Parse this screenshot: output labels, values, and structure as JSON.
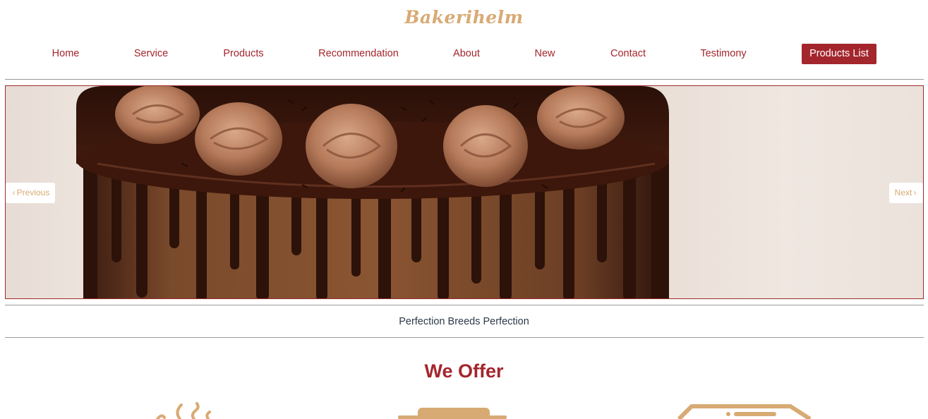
{
  "brand": {
    "name": "Bakerihelm",
    "color": "#d8aa73"
  },
  "nav": {
    "items": [
      "Home",
      "Service",
      "Products",
      "Recommendation",
      "About",
      "New",
      "Contact",
      "Testimony"
    ],
    "cta_label": "Products List",
    "accent_color": "#a3262c"
  },
  "hero": {
    "image_subject": "chocolate drip cake with piped frosting swirls",
    "prev_label": "Previous",
    "next_label": "Next",
    "prev_icon": "chevron-left-icon",
    "next_icon": "chevron-right-icon"
  },
  "tagline": "Perfection Breeds Perfection",
  "offer": {
    "title": "We Offer",
    "icons": [
      "steaming-cup-icon",
      "cake-stand-icon",
      "delivery-truck-icon"
    ]
  }
}
